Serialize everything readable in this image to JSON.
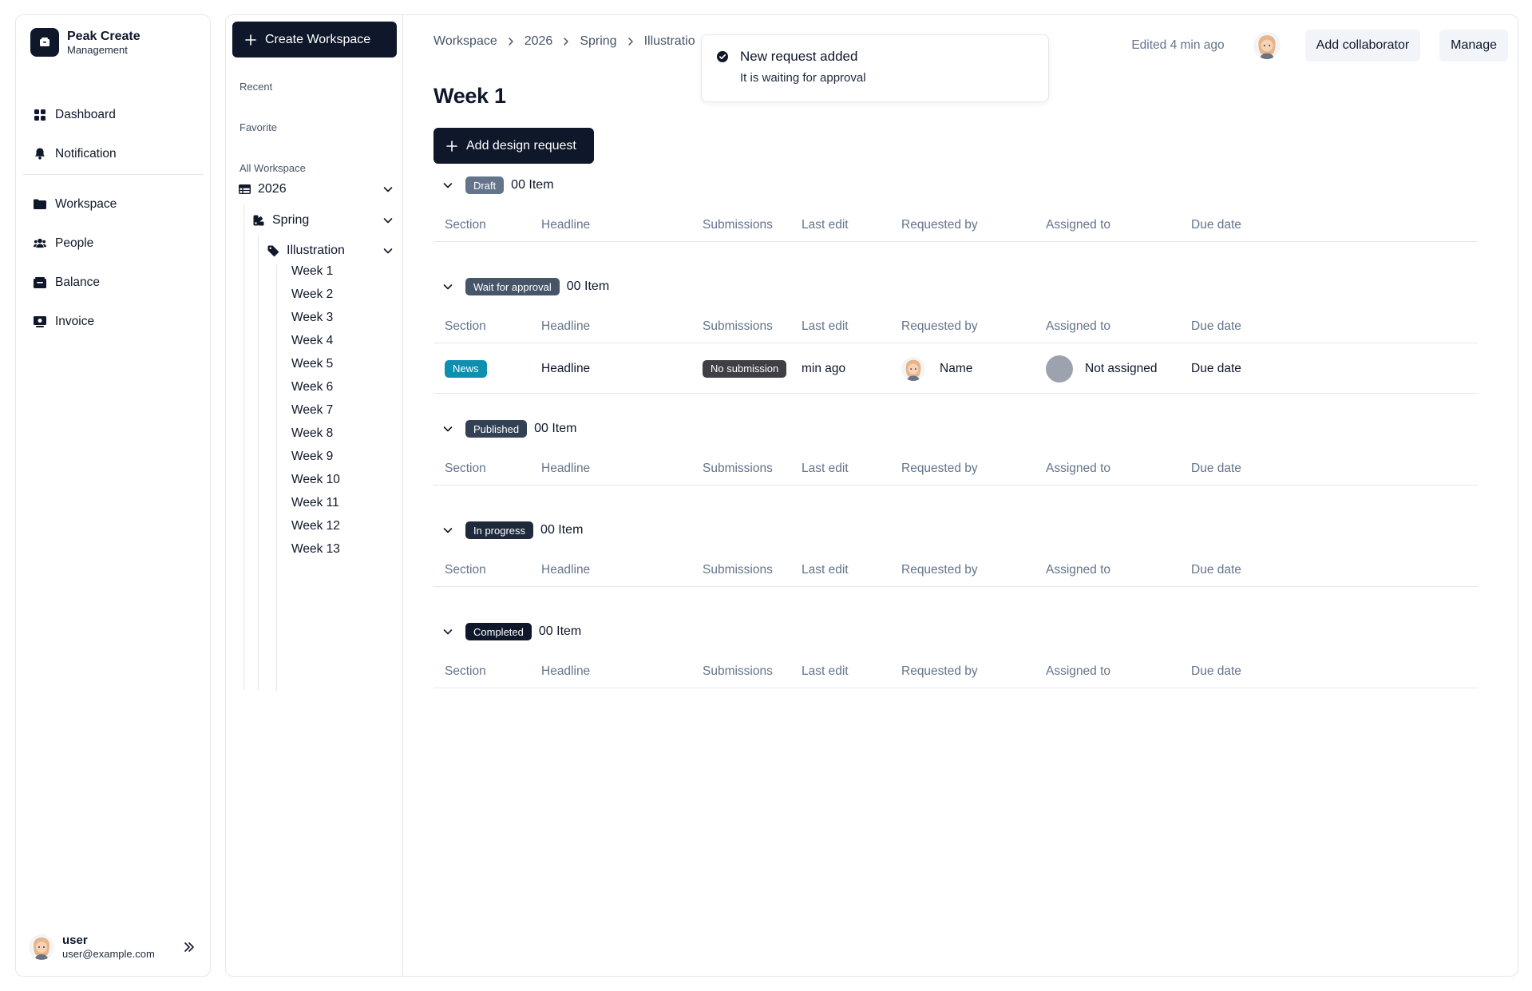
{
  "brand": {
    "name": "Peak Create",
    "subtitle": "Management"
  },
  "nav": {
    "primary": [
      {
        "label": "Dashboard",
        "icon": "grid-icon"
      },
      {
        "label": "Notification",
        "icon": "bell-icon"
      }
    ],
    "secondary": [
      {
        "label": "Workspace",
        "icon": "folder-icon"
      },
      {
        "label": "People",
        "icon": "users-icon"
      },
      {
        "label": "Balance",
        "icon": "wallet-icon"
      },
      {
        "label": "Invoice",
        "icon": "invoice-icon"
      }
    ]
  },
  "user": {
    "name": "user",
    "email": "user@example.com"
  },
  "tree": {
    "create_label": "Create Workspace",
    "recent_label": "Recent",
    "favorite_label": "Favorite",
    "all_label": "All Workspace",
    "year": "2026",
    "season": "Spring",
    "category": "Illustration",
    "weeks": [
      "Week 1",
      "Week 2",
      "Week 3",
      "Week 4",
      "Week 5",
      "Week 6",
      "Week 7",
      "Week 8",
      "Week 9",
      "Week 10",
      "Week 11",
      "Week 12",
      "Week 13"
    ]
  },
  "breadcrumb": [
    "Workspace",
    "2026",
    "Spring",
    "Illustratio"
  ],
  "header": {
    "edited": "Edited 4 min ago",
    "add_collaborator": "Add collaborator",
    "manage": "Manage"
  },
  "toast": {
    "title": "New request added",
    "description": "It is waiting for approval"
  },
  "page": {
    "title": "Week 1",
    "add_request_label": "Add design request"
  },
  "columns": [
    "Section",
    "Headline",
    "Submissions",
    "Last edit",
    "Requested by",
    "Assigned to",
    "Due date"
  ],
  "groups": [
    {
      "status": "Draft",
      "count": "00 Item",
      "color": "#64748b",
      "rows": []
    },
    {
      "status": "Wait for approval",
      "count": "00 Item",
      "color": "#475569",
      "rows": [
        {
          "section": "News",
          "headline": "Headline",
          "submissions": "No submission",
          "last_edit": "min ago",
          "requested_by": "Name",
          "assigned_to": "Not assigned",
          "due_date": "Due date"
        }
      ]
    },
    {
      "status": "Published",
      "count": "00 Item",
      "color": "#334155",
      "rows": []
    },
    {
      "status": "In progress",
      "count": "00 Item",
      "color": "#1e293b",
      "rows": []
    },
    {
      "status": "Completed",
      "count": "00 Item",
      "color": "#0f172a",
      "rows": []
    }
  ],
  "colors": {
    "primary": "#0f172a",
    "border": "#e5e7eb",
    "section_tag": "#0e8fb0",
    "muted": "#64748b"
  }
}
